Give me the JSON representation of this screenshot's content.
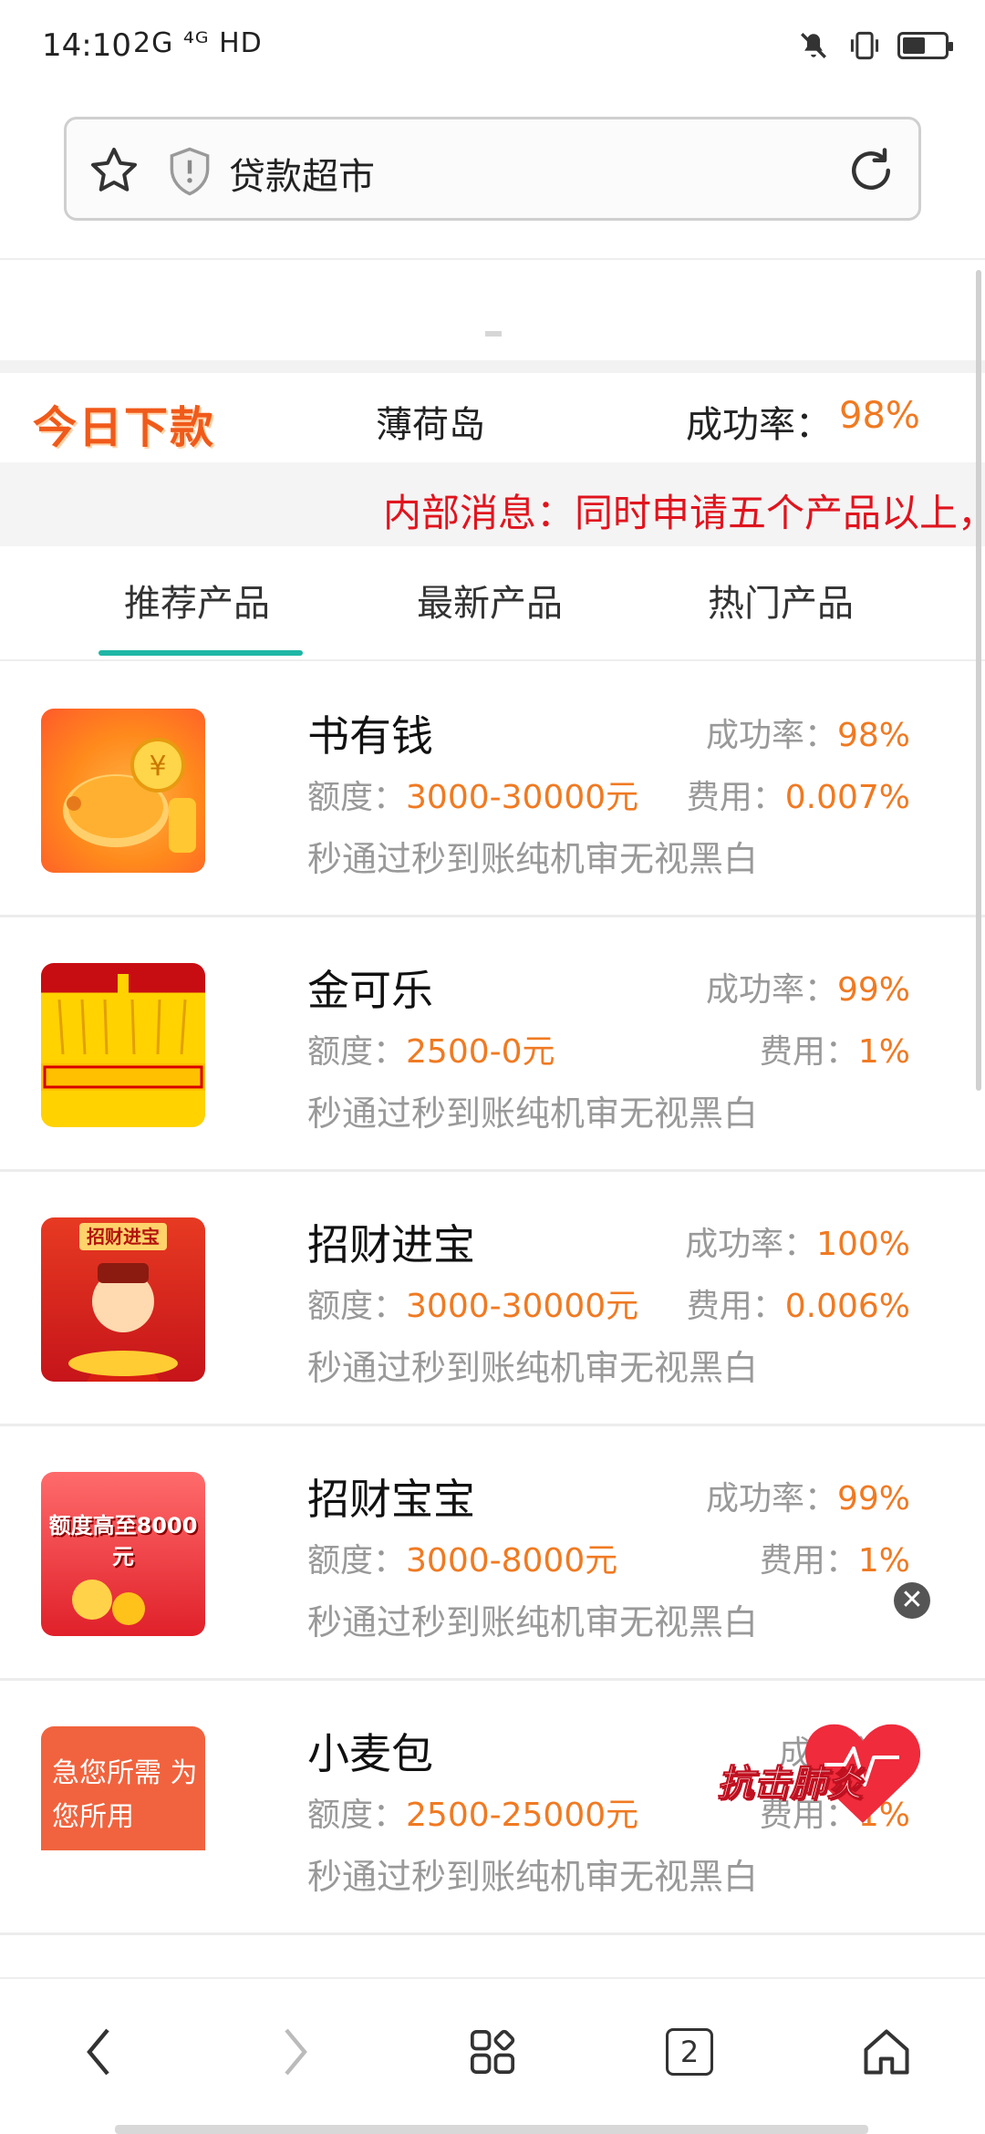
{
  "status_bar": {
    "time": "14:10",
    "network": "2G ⁴ᴳ HD",
    "battery_level": 0.55
  },
  "address_bar": {
    "title": "贷款超市"
  },
  "today": {
    "logo_text": "今日下款",
    "name": "薄荷岛",
    "rate_label": "成功率：",
    "rate_value": "98%"
  },
  "marquee": {
    "text": "内部消息：同时申请五个产品以上，"
  },
  "tabs": [
    {
      "label": "推荐产品",
      "active": true
    },
    {
      "label": "最新产品",
      "active": false
    },
    {
      "label": "热门产品",
      "active": false
    }
  ],
  "products": [
    {
      "name": "书有钱",
      "rate_label": "成功率：",
      "rate": "98%",
      "amount_label": "额度：",
      "amount": "3000-30000元",
      "fee_label": "费用：",
      "fee": "0.007%",
      "desc": "秒通过秒到账纯机审无视黑白"
    },
    {
      "name": "金可乐",
      "rate_label": "成功率：",
      "rate": "99%",
      "amount_label": "额度：",
      "amount": "2500-0元",
      "fee_label": "费用：",
      "fee": "1%",
      "desc": "秒通过秒到账纯机审无视黑白"
    },
    {
      "name": "招财进宝",
      "rate_label": "成功率：",
      "rate": "100%",
      "amount_label": "额度：",
      "amount": "3000-30000元",
      "fee_label": "费用：",
      "fee": "0.006%",
      "desc": "秒通过秒到账纯机审无视黑白",
      "thumb_text": "招财进宝"
    },
    {
      "name": "招财宝宝",
      "rate_label": "成功率：",
      "rate": "99%",
      "amount_label": "额度：",
      "amount": "3000-8000元",
      "fee_label": "费用：",
      "fee": "1%",
      "desc": "秒通过秒到账纯机审无视黑白",
      "thumb_text": "额度高至8000元"
    },
    {
      "name": "小麦包",
      "rate_label": "成功率：",
      "rate": "",
      "amount_label": "额度：",
      "amount": "2500-25000元",
      "fee_label": "费用：",
      "fee": "1%",
      "desc": "秒通过秒到账纯机审无视黑白",
      "thumb_text": "急您所需 为您所用"
    }
  ],
  "floating_ad": {
    "text": "抗击肺炎",
    "close_glyph": "✕"
  },
  "bottom_nav": {
    "tab_count": "2",
    "icons": [
      "back-icon",
      "forward-icon",
      "apps-icon",
      "tabs-icon",
      "home-icon"
    ]
  },
  "colors": {
    "accent_orange": "#f07a22",
    "marquee_red": "#e0141e",
    "tab_underline": "#1fb6a5"
  }
}
